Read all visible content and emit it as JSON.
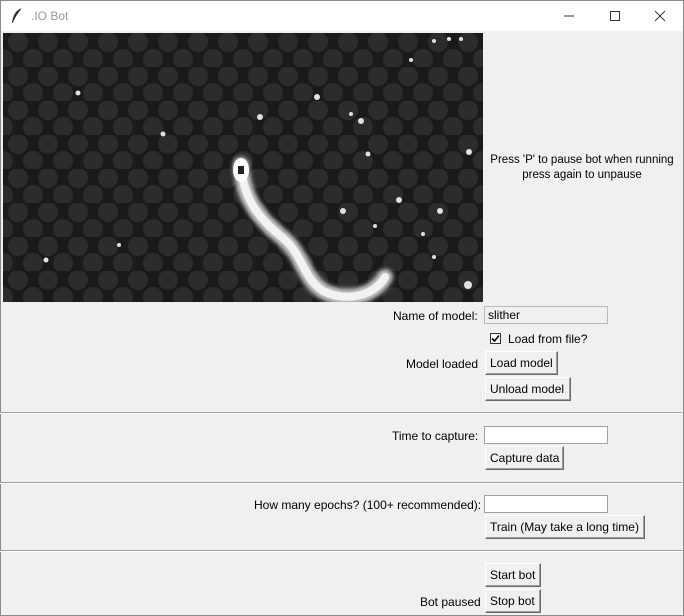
{
  "window": {
    "title": ".IO Bot"
  },
  "preview": {
    "icon": "game-capture-image"
  },
  "hint": {
    "line1": "Press 'P' to pause bot when running",
    "line2": "press again to unpause"
  },
  "model": {
    "name_label": "Name of model:",
    "name_value": "slither",
    "load_from_file_label": "Load from file?",
    "load_from_file_checked": true,
    "status_text": "Model loaded",
    "load_button": "Load model",
    "unload_button": "Unload model"
  },
  "capture": {
    "time_label": "Time to capture:",
    "time_value": "",
    "capture_button": "Capture data"
  },
  "train": {
    "epochs_label": "How many epochs? (100+ recommended):",
    "epochs_value": "",
    "train_button": "Train (May take a long time)"
  },
  "bot": {
    "start_button": "Start bot",
    "stop_button": "Stop bot",
    "status_text": "Bot paused"
  }
}
